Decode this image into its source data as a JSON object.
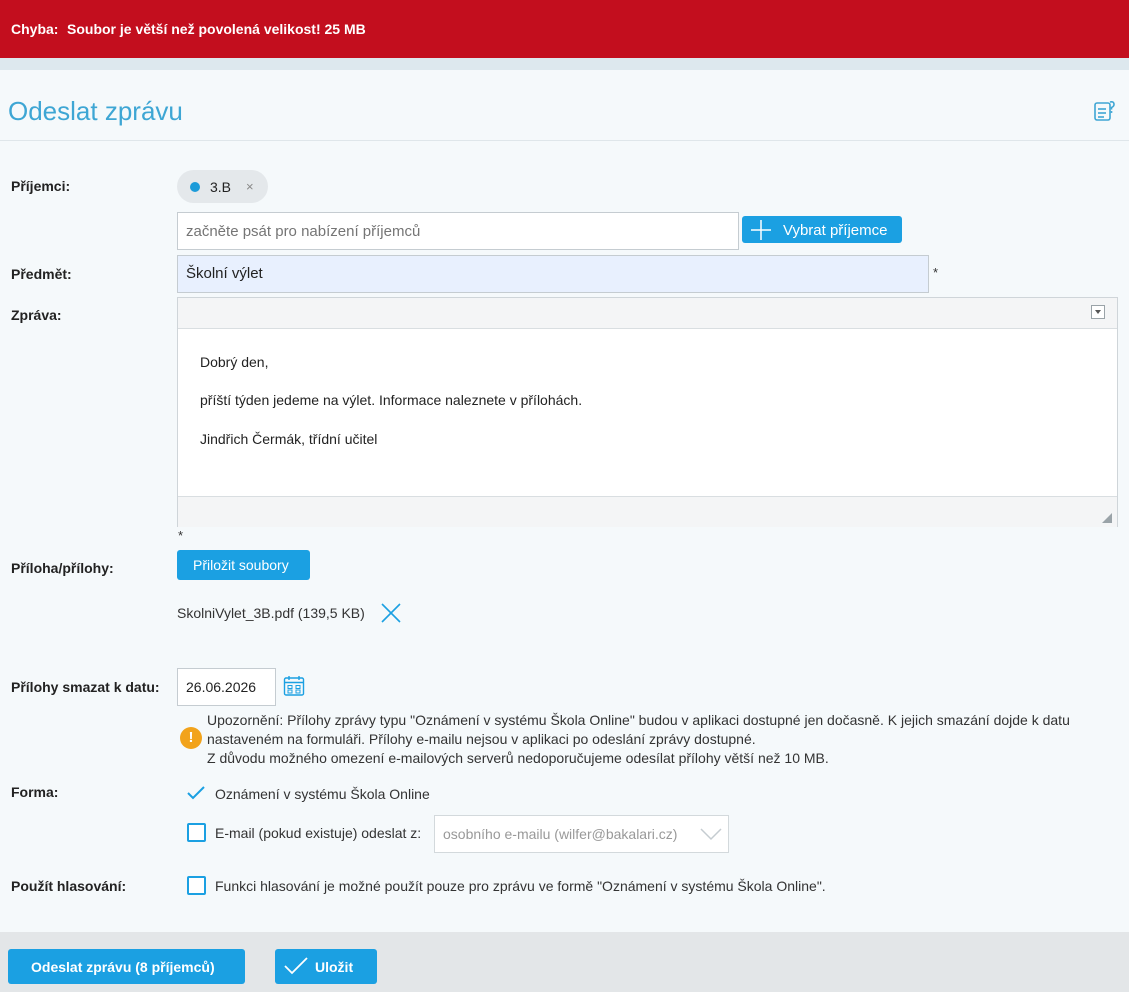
{
  "error": {
    "label": "Chyba:",
    "message": "Soubor je větší než povolená velikost! 25 MB"
  },
  "page": {
    "title": "Odeslat zprávu"
  },
  "recipients": {
    "label": "Příjemci:",
    "chip": "3.B",
    "chip_remove": "×",
    "placeholder": "začněte psát pro nabízení příjemců",
    "select_button": "Vybrat příjemce"
  },
  "subject": {
    "label": "Předmět:",
    "value": "Školní výlet",
    "required": "*"
  },
  "message": {
    "label": "Zpráva:",
    "lines": [
      "Dobrý den,",
      "příští týden jedeme na výlet. Informace naleznete v přílohách.",
      "Jindřich Čermák, třídní učitel"
    ],
    "required": "*"
  },
  "attachments": {
    "label": "Příloha/přílohy:",
    "button": "Přiložit soubory",
    "file": "SkolniVylet_3B.pdf (139,5 KB)"
  },
  "delete_date": {
    "label": "Přílohy smazat k datu:",
    "value": "26.06.2026"
  },
  "warning": {
    "icon": "!",
    "line1": "Upozornění: Přílohy zprávy typu \"Oznámení v systému Škola Online\" budou v aplikaci dostupné jen dočasně. K jejich smazání dojde k datu nastaveném na formuláři. Přílohy e-mailu nejsou v aplikaci po odeslání zprávy dostupné.",
    "line2": "Z důvodu možného omezení e-mailových serverů nedoporučujeme odesílat přílohy větší než 10 MB."
  },
  "form": {
    "label": "Forma:",
    "option1": "Oznámení v systému Škola Online",
    "option2": "E-mail (pokud existuje) odeslat z:",
    "email_select": "osobního e-mailu (wilfer@bakalari.cz)"
  },
  "voting": {
    "label": "Použít hlasování:",
    "text": "Funkci hlasování je možné použít pouze pro zprávu ve formě \"Oznámení v systému Škola Online\"."
  },
  "footer": {
    "send": "Odeslat zprávu (8 příjemců)",
    "save": "Uložit"
  },
  "colors": {
    "error_bar": "#c30e1e",
    "accent": "#1ba0e2",
    "title": "#3ea6d4",
    "warning": "#f2a31b"
  }
}
